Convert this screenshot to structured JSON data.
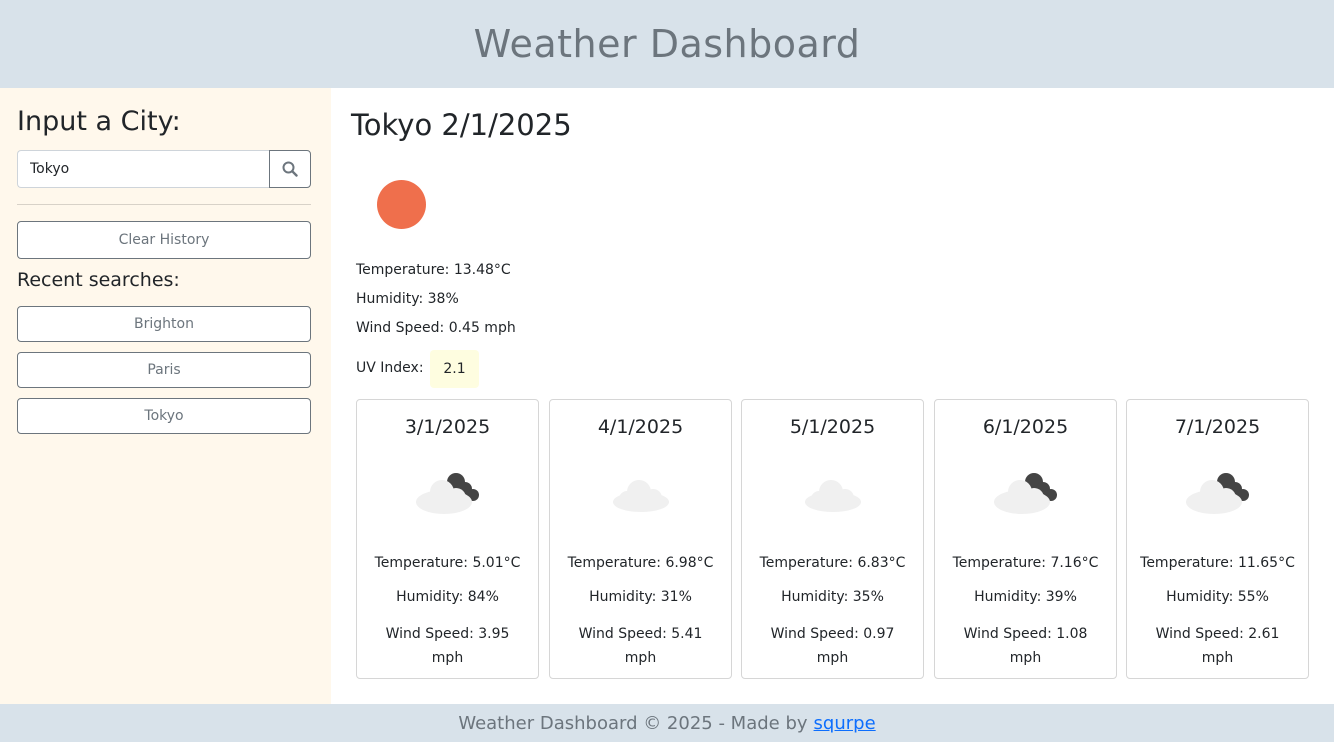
{
  "header": {
    "title": "Weather Dashboard"
  },
  "sidebar": {
    "heading": "Input a City:",
    "search": {
      "value": "Tokyo",
      "button_icon": "search-icon"
    },
    "clear_label": "Clear History",
    "recent_title": "Recent searches:",
    "history": [
      "Brighton",
      "Paris",
      "Tokyo"
    ]
  },
  "current": {
    "title": "Tokyo 2/1/2025",
    "icon": "sun-icon",
    "temperature": "Temperature: 13.48°C",
    "humidity": "Humidity: 38%",
    "wind": "Wind Speed: 0.45 mph",
    "uv_label": "UV Index:",
    "uv_value": "2.1",
    "sun_color": "#ef6f4c",
    "uv_color": "#fefde0"
  },
  "forecast": [
    {
      "date": "3/1/2025",
      "icon": "night-cloudy-icon",
      "temp": "Temperature: 5.01°C",
      "humidity": "Humidity: 84%",
      "wind": "Wind Speed: 3.95 mph"
    },
    {
      "date": "4/1/2025",
      "icon": "cloud-icon",
      "temp": "Temperature: 6.98°C",
      "humidity": "Humidity: 31%",
      "wind": "Wind Speed: 5.41 mph"
    },
    {
      "date": "5/1/2025",
      "icon": "cloud-icon",
      "temp": "Temperature: 6.83°C",
      "humidity": "Humidity: 35%",
      "wind": "Wind Speed: 0.97 mph"
    },
    {
      "date": "6/1/2025",
      "icon": "night-cloudy-icon",
      "temp": "Temperature: 7.16°C",
      "humidity": "Humidity: 39%",
      "wind": "Wind Speed: 1.08 mph"
    },
    {
      "date": "7/1/2025",
      "icon": "night-cloudy-icon",
      "temp": "Temperature: 11.65°C",
      "humidity": "Humidity: 55%",
      "wind": "Wind Speed: 2.61 mph"
    }
  ],
  "footer": {
    "text": "Weather Dashboard © 2025 - Made by",
    "link": "squrpe"
  }
}
